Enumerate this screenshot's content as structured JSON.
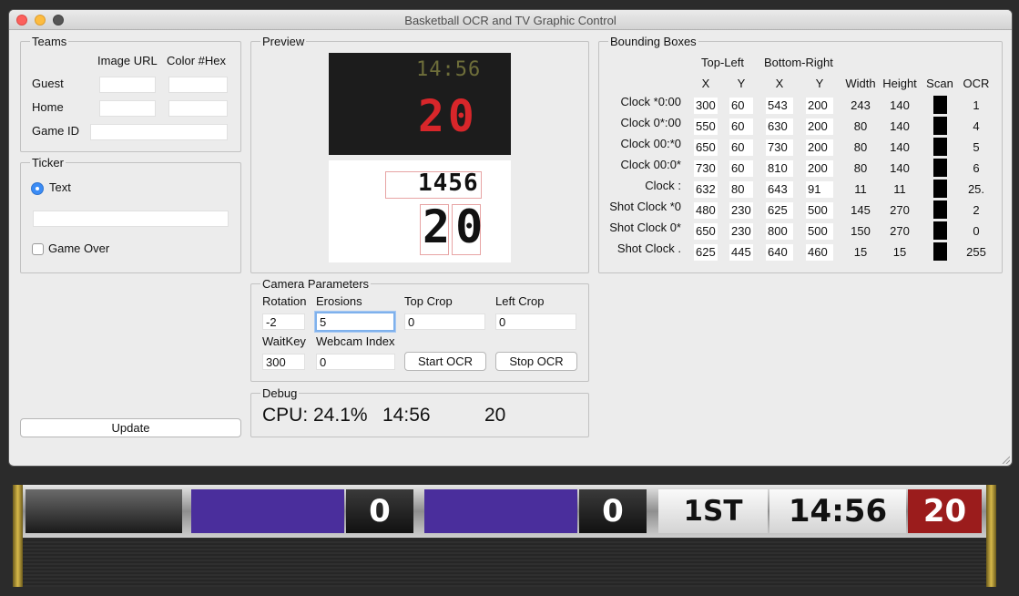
{
  "window": {
    "title": "Basketball OCR and TV Graphic Control"
  },
  "teams": {
    "title": "Teams",
    "col_image_url": "Image URL",
    "col_color_hex": "Color #Hex",
    "guest_label": "Guest",
    "home_label": "Home",
    "game_id_label": "Game ID",
    "guest_image_url": "",
    "guest_color": "",
    "home_image_url": "",
    "home_color": "",
    "game_id": ""
  },
  "ticker": {
    "title": "Ticker",
    "text_option": "Text",
    "text_value": "",
    "game_over_label": "Game Over",
    "game_over_checked": false
  },
  "update_button": "Update",
  "preview": {
    "title": "Preview",
    "clock_digits": "14:56",
    "shot_digits": "20",
    "ocr_clock_digits": "1456",
    "ocr_shot_digits": "20"
  },
  "camera": {
    "title": "Camera Parameters",
    "rotation_label": "Rotation",
    "erosions_label": "Erosions",
    "top_crop_label": "Top Crop",
    "left_crop_label": "Left Crop",
    "waitkey_label": "WaitKey",
    "webcam_index_label": "Webcam Index",
    "rotation": "-2",
    "erosions": "5",
    "top_crop": "0",
    "left_crop": "0",
    "waitkey": "300",
    "webcam_index": "0",
    "start_ocr": "Start OCR",
    "stop_ocr": "Stop OCR"
  },
  "debug": {
    "title": "Debug",
    "cpu": "CPU: 24.1%",
    "clock": "14:56",
    "shot_clock": "20"
  },
  "bounding_boxes": {
    "title": "Bounding Boxes",
    "top_left_header": "Top-Left",
    "bottom_right_header": "Bottom-Right",
    "columns": [
      "X",
      "Y",
      "X",
      "Y",
      "Width",
      "Height",
      "Scan",
      "OCR"
    ],
    "rows": [
      {
        "label": "Clock *0:00",
        "x1": "300",
        "y1": "60",
        "x2": "543",
        "y2": "200",
        "width": "243",
        "height": "140",
        "ocr": "1"
      },
      {
        "label": "Clock 0*:00",
        "x1": "550",
        "y1": "60",
        "x2": "630",
        "y2": "200",
        "width": "80",
        "height": "140",
        "ocr": "4"
      },
      {
        "label": "Clock 00:*0",
        "x1": "650",
        "y1": "60",
        "x2": "730",
        "y2": "200",
        "width": "80",
        "height": "140",
        "ocr": "5"
      },
      {
        "label": "Clock 00:0*",
        "x1": "730",
        "y1": "60",
        "x2": "810",
        "y2": "200",
        "width": "80",
        "height": "140",
        "ocr": "6"
      },
      {
        "label": "Clock :",
        "x1": "632",
        "y1": "80",
        "x2": "643",
        "y2": "91",
        "width": "11",
        "height": "11",
        "ocr": "25."
      },
      {
        "label": "Shot Clock *0",
        "x1": "480",
        "y1": "230",
        "x2": "625",
        "y2": "500",
        "width": "145",
        "height": "270",
        "ocr": "2"
      },
      {
        "label": "Shot Clock 0*",
        "x1": "650",
        "y1": "230",
        "x2": "800",
        "y2": "500",
        "width": "150",
        "height": "270",
        "ocr": "0"
      },
      {
        "label": "Shot Clock .",
        "x1": "625",
        "y1": "445",
        "x2": "640",
        "y2": "460",
        "width": "15",
        "height": "15",
        "ocr": "255"
      }
    ]
  },
  "scoreboard": {
    "guest_score": "0",
    "home_score": "0",
    "period": "1ST",
    "clock": "14:56",
    "shot_clock": "20",
    "team_color": "#4a2e9c",
    "shot_clock_color": "#9b1c1c"
  }
}
